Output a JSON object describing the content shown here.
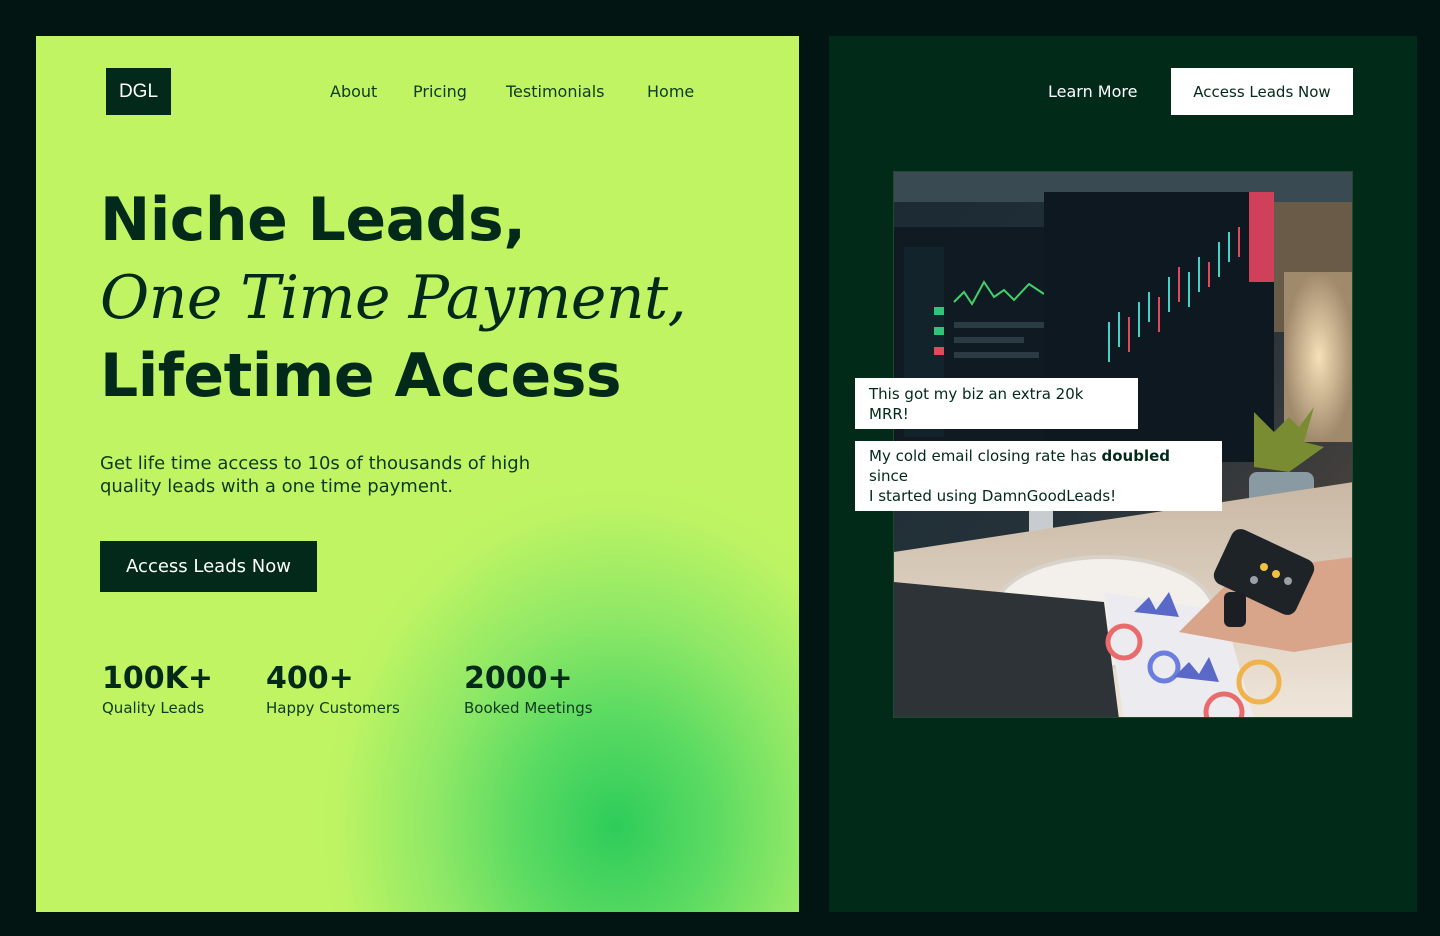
{
  "logo": "DGL",
  "nav": {
    "about": "About",
    "pricing": "Pricing",
    "testimonials": "Testimonials",
    "home": "Home"
  },
  "hero": {
    "line1": "Niche Leads,",
    "line2": "One Time Payment,",
    "line3": "Lifetime Access",
    "subtitle_line1": "Get life time access to 10s of thousands of high",
    "subtitle_line2": "quality leads with a one time payment.",
    "cta": "Access Leads Now"
  },
  "stats": [
    {
      "value": "100K+",
      "label": "Quality Leads"
    },
    {
      "value": "400+",
      "label": "Happy Customers"
    },
    {
      "value": "2000+",
      "label": "Booked Meetings"
    }
  ],
  "header_right": {
    "learn_more": "Learn More",
    "cta": "Access Leads Now"
  },
  "testimonials": {
    "t1": "This got my biz an extra 20k MRR!",
    "t2_pre": "My cold email closing rate has ",
    "t2_bold": "doubled",
    "t2_post": " since",
    "t2_line2": "I started using DamnGoodLeads!"
  },
  "colors": {
    "page_bg": "#031512",
    "lime": "#c1f463",
    "deep_green": "#03291a",
    "right_panel": "#022a18"
  }
}
